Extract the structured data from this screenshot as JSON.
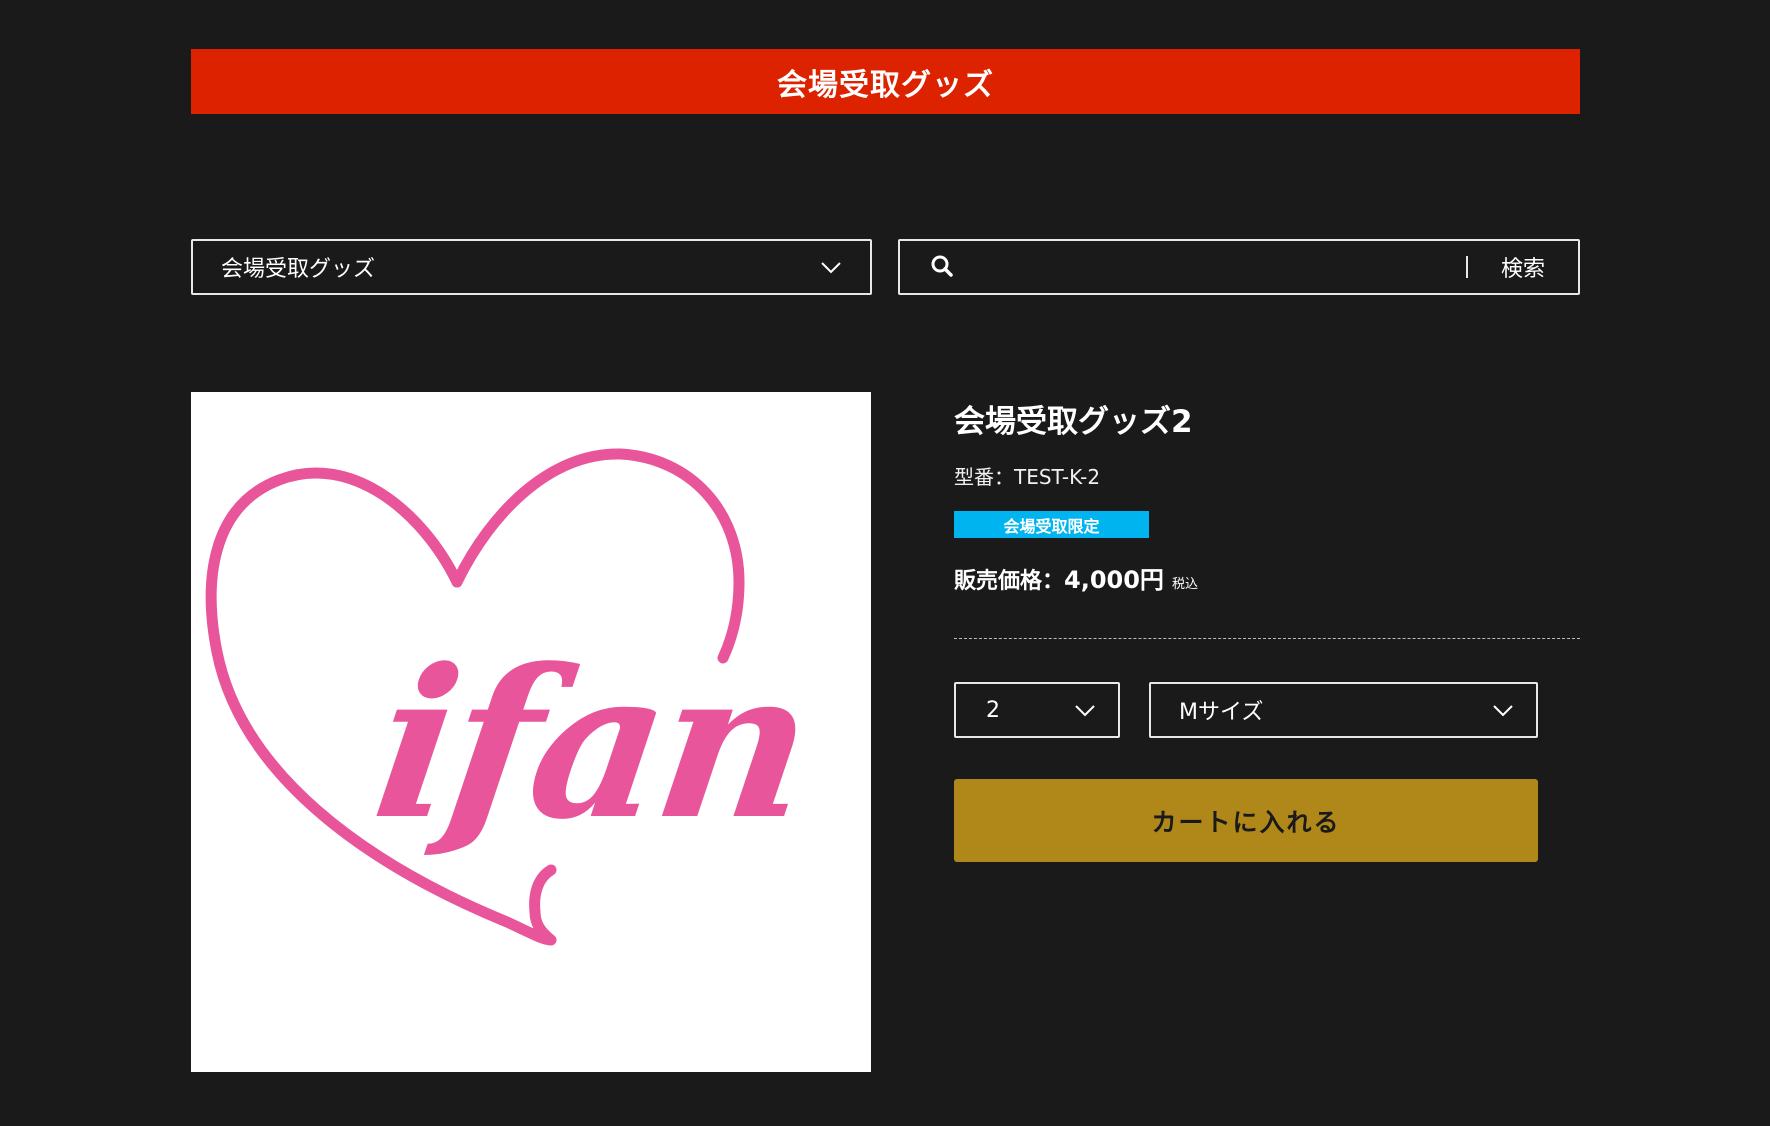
{
  "colors": {
    "background": "#1a1a1a",
    "banner": "#dd2200",
    "badge": "#00b4ef",
    "cart_button": "#b08719",
    "logo_pink": "#e8559a"
  },
  "banner": {
    "title": "会場受取グッズ"
  },
  "filters": {
    "category_value": "会場受取グッズ",
    "category_icon": "chevron-down-icon",
    "search_icon": "search-icon",
    "search_placeholder": "",
    "search_value": "",
    "search_button": "検索"
  },
  "product": {
    "image_logo_text": "ifan",
    "title": "会場受取グッズ2",
    "model_number": "型番：TEST-K-2",
    "badge": "会場受取限定",
    "price_label": "販売価格：",
    "price_value": "4,000円",
    "tax_note": "税込",
    "quantity": "2",
    "size": "Mサイズ",
    "add_to_cart": "カートに入れる"
  }
}
